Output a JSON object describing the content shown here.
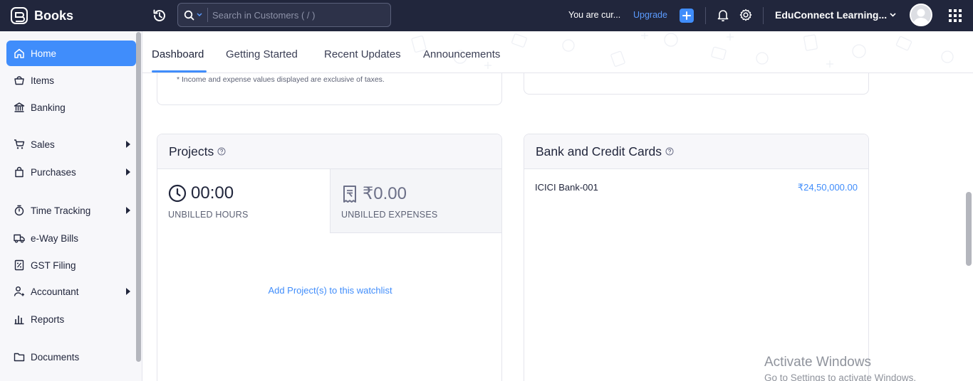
{
  "app": {
    "name": "Books"
  },
  "search": {
    "placeholder": "Search in Customers ( / )"
  },
  "header": {
    "trial_text": "You are cur...",
    "upgrade_label": "Upgrade",
    "org_name": "EduConnect Learning..."
  },
  "sidebar": {
    "items": [
      {
        "label": "Home",
        "icon": "home-icon",
        "active": true
      },
      {
        "label": "Items",
        "icon": "basket-icon"
      },
      {
        "label": "Banking",
        "icon": "bank-icon"
      },
      {
        "label": "Sales",
        "icon": "cart-icon",
        "expandable": true
      },
      {
        "label": "Purchases",
        "icon": "bag-icon",
        "expandable": true
      },
      {
        "label": "Time Tracking",
        "icon": "stopwatch-icon",
        "expandable": true
      },
      {
        "label": "e-Way Bills",
        "icon": "truck-icon"
      },
      {
        "label": "GST Filing",
        "icon": "percent-doc-icon"
      },
      {
        "label": "Accountant",
        "icon": "accountant-icon",
        "expandable": true
      },
      {
        "label": "Reports",
        "icon": "bar-chart-icon"
      },
      {
        "label": "Documents",
        "icon": "folder-icon"
      }
    ]
  },
  "tabs": [
    {
      "label": "Dashboard",
      "active": true
    },
    {
      "label": "Getting Started"
    },
    {
      "label": "Recent Updates"
    },
    {
      "label": "Announcements"
    }
  ],
  "income_card": {
    "note": "* Income and expense values displayed are exclusive of taxes."
  },
  "projects": {
    "title": "Projects",
    "unbilled_hours": {
      "value": "00:00",
      "label": "UNBILLED HOURS"
    },
    "unbilled_expenses": {
      "value": "₹0.00",
      "label": "UNBILLED EXPENSES"
    },
    "watchlist_link": "Add Project(s) to this watchlist"
  },
  "bank_cards": {
    "title": "Bank and Credit Cards",
    "accounts": [
      {
        "name": "ICICI Bank-001",
        "amount": "₹24,50,000.00"
      }
    ]
  },
  "watermark": {
    "title": "Activate Windows",
    "subtitle": "Go to Settings to activate Windows."
  },
  "colors": {
    "topbar": "#21263c",
    "accent": "#408dfb",
    "sidebar_bg": "#f7f7fa"
  }
}
